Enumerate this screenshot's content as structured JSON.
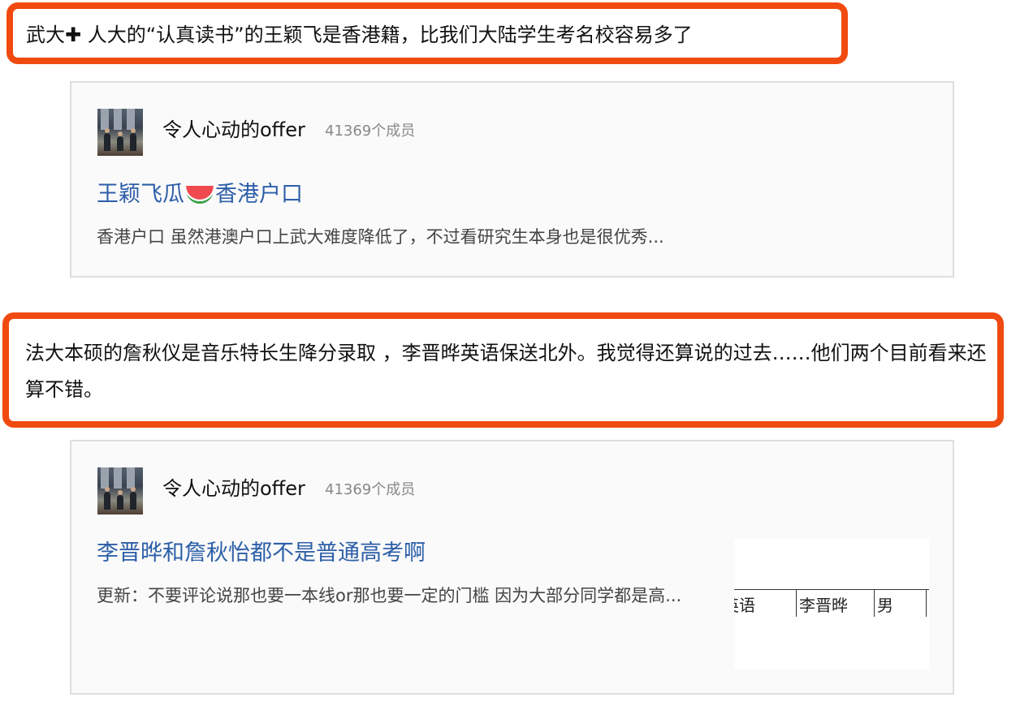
{
  "highlight_1": {
    "text": "武大✚ 人大的“认真读书”的王颖飞是香港籍，比我们大陆学生考名校容易多了"
  },
  "card_1": {
    "group_name": "令人心动的offer",
    "member_count": "41369个成员",
    "title_before": "王颖飞瓜",
    "title_after": "香港户口",
    "excerpt": "香港户口 虽然港澳户口上武大难度降低了，不过看研究生本身也是很优秀..."
  },
  "highlight_2": {
    "text": "法大本硕的詹秋仪是音乐特长生降分录取 ，李晋晔英语保送北外。我觉得还算说的过去……他们两个目前看来还算不错。"
  },
  "card_2": {
    "group_name": "令人心动的offer",
    "member_count": "41369个成员",
    "title": "李晋晔和詹秋怡都不是普通高考啊",
    "excerpt": "更新：不要评论说那也要一本线or那也要一定的门槛 因为大部分同学都是高...",
    "thumbnail": {
      "cells": [
        "英语",
        "李晋晔",
        "男"
      ]
    }
  }
}
